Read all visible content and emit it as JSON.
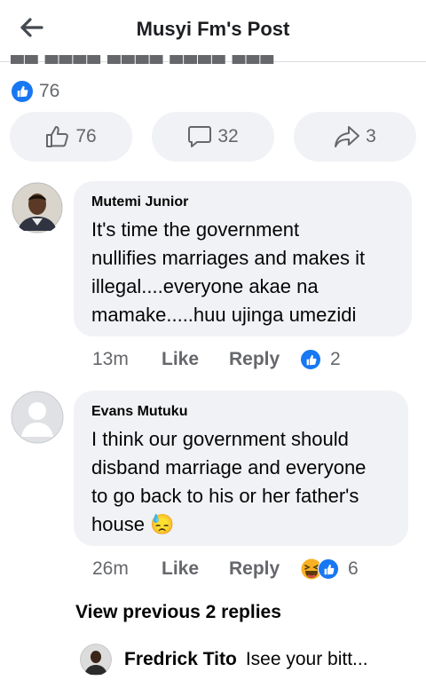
{
  "header": {
    "title": "Musyi Fm's Post",
    "back_icon": "back-arrow-icon"
  },
  "post": {
    "reaction_count": "76",
    "actions": {
      "like_count": "76",
      "comment_count": "32",
      "share_count": "3"
    }
  },
  "comments": [
    {
      "author": "Mutemi Junior",
      "text": "It's time the government\nnullifies marriages and makes it\nillegal....everyone akae na\nmamake.....huu ujinga umezidi",
      "time": "13m",
      "like_label": "Like",
      "reply_label": "Reply",
      "reaction_count": "2",
      "reactions": [
        "like"
      ]
    },
    {
      "author": "Evans Mutuku",
      "text": "I think our government should\ndisband marriage and everyone\nto go back to his or her father's\nhouse",
      "emoji": "😓",
      "time": "26m",
      "like_label": "Like",
      "reply_label": "Reply",
      "reaction_count": "6",
      "reactions": [
        "haha",
        "like"
      ]
    }
  ],
  "view_previous_replies": "View previous 2 replies",
  "reply_preview": {
    "author": "Fredrick Tito",
    "snippet": "Isee your bitt..."
  },
  "colors": {
    "accent": "#1877f2",
    "bubble": "#f0f2f5",
    "muted": "#65676b"
  }
}
